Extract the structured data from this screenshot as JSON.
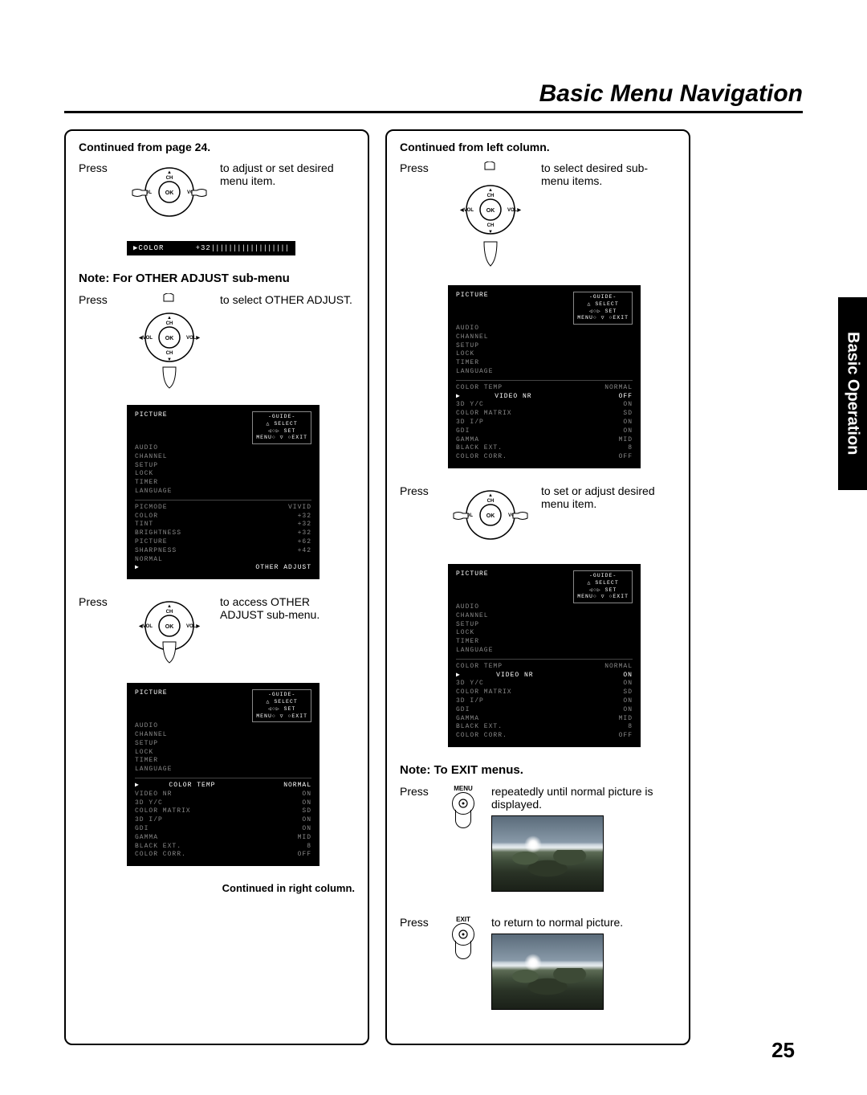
{
  "page": {
    "title": "Basic Menu Navigation",
    "side_tab": "Basic Operation",
    "page_number": "25"
  },
  "left": {
    "continued": "Continued from page 24.",
    "step1": {
      "press": "Press",
      "desc": "to adjust or set desired menu item."
    },
    "osd_bar": {
      "label": "COLOR",
      "value": "+32",
      "gauge": "||||||||||||||||||"
    },
    "note1": "Note: For OTHER ADJUST sub-menu",
    "step2": {
      "press": "Press",
      "desc": "to select OTHER ADJUST."
    },
    "osd1": {
      "hdr": "PICTURE",
      "guide_top": "-GUIDE-",
      "guide1": "SELECT",
      "guide2": "SET",
      "guide3a": "MENU",
      "guide3b": "EXIT",
      "menu": [
        "PICTURE",
        "AUDIO",
        "CHANNEL",
        "SETUP",
        "LOCK",
        "TIMER",
        "LANGUAGE"
      ],
      "rows": [
        {
          "l": "PICMODE",
          "r": "VIVID"
        },
        {
          "l": "COLOR",
          "r": "+32"
        },
        {
          "l": "TINT",
          "r": "+32"
        },
        {
          "l": "BRIGHTNESS",
          "r": "+32"
        },
        {
          "l": "PICTURE",
          "r": "+62"
        },
        {
          "l": "SHARPNESS",
          "r": "+42"
        },
        {
          "l": "NORMAL",
          "r": ""
        }
      ],
      "last": "OTHER ADJUST"
    },
    "step3": {
      "press": "Press",
      "desc": "to access OTHER ADJUST sub-menu."
    },
    "osd2": {
      "hdr": "PICTURE",
      "sel": {
        "l": "COLOR TEMP",
        "r": "NORMAL"
      },
      "rows": [
        {
          "l": "VIDEO NR",
          "r": "ON"
        },
        {
          "l": "3D Y/C",
          "r": "ON"
        },
        {
          "l": "COLOR MATRIX",
          "r": "SD"
        },
        {
          "l": "3D I/P",
          "r": "ON"
        },
        {
          "l": "GDI",
          "r": "ON"
        },
        {
          "l": "GAMMA",
          "r": "MID"
        },
        {
          "l": "BLACK EXT.",
          "r": "8"
        },
        {
          "l": "COLOR CORR.",
          "r": "OFF"
        }
      ]
    },
    "foot": "Continued in right column."
  },
  "right": {
    "continued": "Continued from left column.",
    "step1": {
      "press": "Press",
      "desc": "to select desired sub-menu items."
    },
    "osd1": {
      "hdr": "PICTURE",
      "rows_a": [
        {
          "l": "COLOR TEMP",
          "r": "NORMAL"
        }
      ],
      "sel": {
        "l": "VIDEO NR",
        "r": "OFF"
      },
      "rows_b": [
        {
          "l": "3D Y/C",
          "r": "ON"
        },
        {
          "l": "COLOR MATRIX",
          "r": "SD"
        },
        {
          "l": "3D I/P",
          "r": "ON"
        },
        {
          "l": "GDI",
          "r": "ON"
        },
        {
          "l": "GAMMA",
          "r": "MID"
        },
        {
          "l": "BLACK EXT.",
          "r": "8"
        },
        {
          "l": "COLOR CORR.",
          "r": "OFF"
        }
      ]
    },
    "step2": {
      "press": "Press",
      "desc": "to set or adjust desired menu item."
    },
    "osd2": {
      "hdr": "PICTURE",
      "rows_a": [
        {
          "l": "COLOR TEMP",
          "r": "NORMAL"
        }
      ],
      "sel": {
        "l": "VIDEO NR",
        "r": "ON"
      },
      "rows_b": [
        {
          "l": "3D Y/C",
          "r": "ON"
        },
        {
          "l": "COLOR MATRIX",
          "r": "SD"
        },
        {
          "l": "3D I/P",
          "r": "ON"
        },
        {
          "l": "GDI",
          "r": "ON"
        },
        {
          "l": "GAMMA",
          "r": "MID"
        },
        {
          "l": "BLACK EXT.",
          "r": "8"
        },
        {
          "l": "COLOR CORR.",
          "r": "OFF"
        }
      ]
    },
    "note_exit": "Note: To EXIT menus.",
    "exit1": {
      "press": "Press",
      "btn": "MENU",
      "desc": "repeatedly until normal picture is displayed."
    },
    "exit2": {
      "press": "Press",
      "btn": "EXIT",
      "desc": "to return to normal picture."
    }
  },
  "pad_labels": {
    "ch": "CH",
    "ok": "OK",
    "vol": "VOL"
  }
}
